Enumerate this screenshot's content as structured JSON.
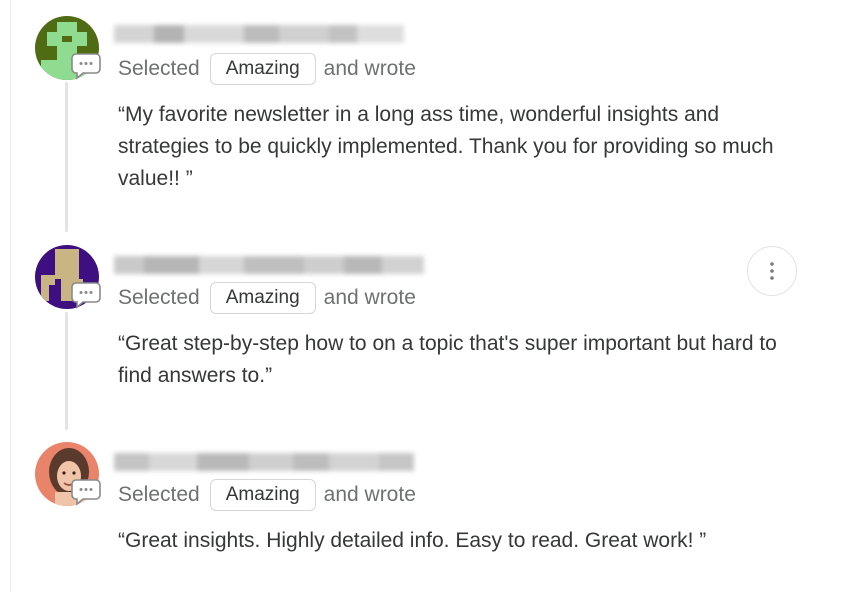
{
  "comments": [
    {
      "meta_prefix": "Selected",
      "rating": "Amazing",
      "meta_suffix": "and wrote",
      "quote": "“My favorite newsletter in a long ass time, wonderful insights and strategies to be quickly implemented. Thank you for providing so much value!! ”",
      "avatar_colors": {
        "bg": "#4f6b14",
        "figure": "#8fdc90"
      }
    },
    {
      "meta_prefix": "Selected",
      "rating": "Amazing",
      "meta_suffix": "and wrote",
      "quote": "“Great step-by-step how to on a topic that's super important but hard to find answers to.”",
      "avatar_colors": {
        "bg": "#3d0f80",
        "figure": "#c9b483"
      }
    },
    {
      "meta_prefix": "Selected",
      "rating": "Amazing",
      "meta_suffix": "and wrote",
      "quote": "“Great insights. Highly detailed info. Easy to read. Great work! ”",
      "avatar_colors": {
        "bg": "#e9846a",
        "figure": "#5a3a2c"
      }
    }
  ],
  "icons": {
    "comment": "speech-bubble-icon",
    "more": "more-vertical-icon"
  }
}
